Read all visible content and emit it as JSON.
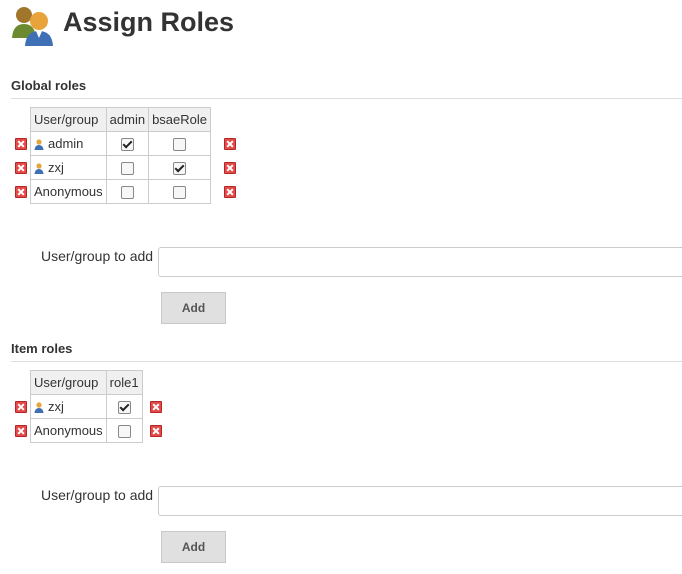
{
  "page": {
    "title": "Assign Roles"
  },
  "global_roles": {
    "title": "Global roles",
    "columns": [
      "User/group",
      "admin",
      "bsaeRole"
    ],
    "rows": [
      {
        "name": "admin",
        "is_user": true,
        "checked": [
          true,
          false
        ]
      },
      {
        "name": "zxj",
        "is_user": true,
        "checked": [
          false,
          true
        ]
      },
      {
        "name": "Anonymous",
        "is_user": false,
        "checked": [
          false,
          false
        ]
      }
    ],
    "add_label": "User/group to add",
    "add_value": "",
    "add_button": "Add"
  },
  "item_roles": {
    "title": "Item roles",
    "columns": [
      "User/group",
      "role1"
    ],
    "rows": [
      {
        "name": "zxj",
        "is_user": true,
        "checked": [
          true
        ]
      },
      {
        "name": "Anonymous",
        "is_user": false,
        "checked": [
          false
        ]
      }
    ],
    "add_label": "User/group to add",
    "add_value": "",
    "add_button": "Add"
  },
  "icons": {
    "header": "users-icon",
    "user": "user-icon",
    "delete": "delete-icon"
  },
  "colors": {
    "delete": "#e34b4b",
    "button_bg": "#e0e0e0",
    "rule": "#dddddd"
  }
}
